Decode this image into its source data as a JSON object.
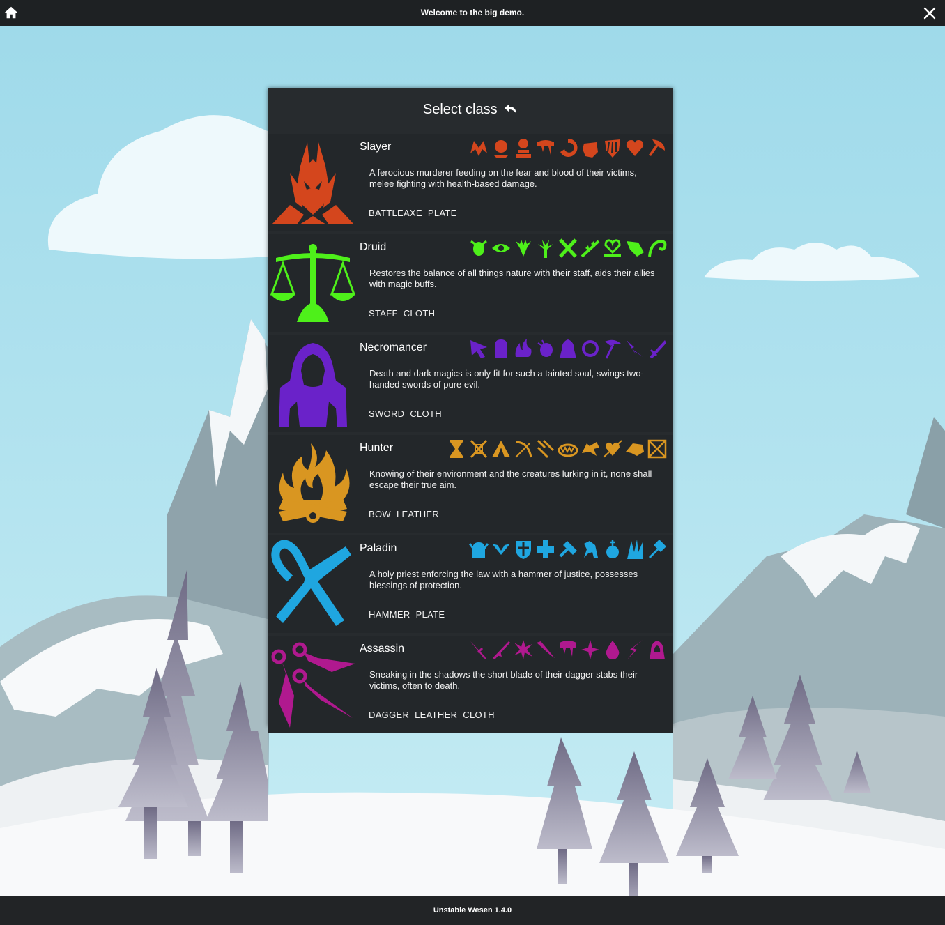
{
  "window": {
    "title": "Welcome to the big demo.",
    "version": "Unstable Wesen 1.4.0"
  },
  "icons": {
    "home": "home-icon",
    "close": "close-icon",
    "back": "back-arrow-icon"
  },
  "panel": {
    "title": "Select class",
    "classes": [
      {
        "name": "Slayer",
        "color": "#d4461d",
        "emblem": "demon-helmet",
        "description": "A ferocious murderer feeding on the fear and blood of their victims, melee fighting with health-based damage.",
        "gear": [
          "BATTLEAXE",
          "PLATE"
        ],
        "skill_count_icons": 9
      },
      {
        "name": "Druid",
        "color": "#4ef01a",
        "emblem": "scales",
        "description": "Restores the balance of all things nature with their staff, aids their allies with magic buffs.",
        "gear": [
          "STAFF",
          "CLOTH"
        ],
        "skill_count_icons": 9
      },
      {
        "name": "Necromancer",
        "color": "#6a22c9",
        "emblem": "hooded-figure",
        "description": "Death and dark magics is only fit for such a tainted soul, swings two-handed swords of pure evil.",
        "gear": [
          "SWORD",
          "CLOTH"
        ],
        "skill_count_icons": 9
      },
      {
        "name": "Hunter",
        "color": "#d99621",
        "emblem": "campfire",
        "description": "Knowing of their environment and the creatures lurking in it, none shall escape their true aim.",
        "gear": [
          "BOW",
          "LEATHER"
        ],
        "skill_count_icons": 10
      },
      {
        "name": "Paladin",
        "color": "#1fa6e0",
        "emblem": "ankh",
        "description": "A holy priest enforcing the law with a hammer of justice, possesses blessings of protection.",
        "gear": [
          "HAMMER",
          "PLATE"
        ],
        "skill_count_icons": 9
      },
      {
        "name": "Assassin",
        "color": "#b0198f",
        "emblem": "kunai",
        "description": "Sneaking in the shadows the short blade of their dagger stabs their victims, often to death.",
        "gear": [
          "DAGGER",
          "LEATHER",
          "CLOTH"
        ],
        "skill_count_icons": 9
      }
    ]
  }
}
